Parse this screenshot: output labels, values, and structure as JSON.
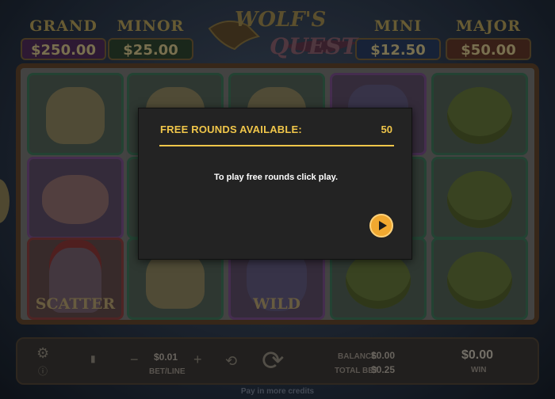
{
  "game": {
    "logo_line1": "WOLF'S",
    "logo_line2": "QUEST"
  },
  "jackpots": [
    {
      "name": "GRAND",
      "value": "$250.00"
    },
    {
      "name": "MINOR",
      "value": "$25.00"
    },
    {
      "name": "MINI",
      "value": "$12.50"
    },
    {
      "name": "MAJOR",
      "value": "$50.00"
    }
  ],
  "reels": {
    "symbols": [
      [
        "eagle",
        "bear",
        "scatter"
      ],
      [
        "eagle",
        "eagle",
        "eagle"
      ],
      [
        "eagle",
        "wolf",
        "wild"
      ],
      [
        "wolf",
        "snake",
        "snake"
      ],
      [
        "snake",
        "snake",
        "snake"
      ]
    ],
    "scatter_label": "SCATTER",
    "wild_label": "WILD"
  },
  "controls": {
    "bet_value": "$0.01",
    "bet_label": "BET/LINE",
    "balance_label": "BALANCE",
    "balance_value": "$0.00",
    "total_bet_label": "TOTAL BET",
    "total_bet_value": "$0.25",
    "win_value": "$0.00",
    "win_label": "WIN",
    "icons": [
      "gear-icon",
      "info-icon",
      "minus-icon",
      "plus-icon",
      "autoplay-icon",
      "spin-icon"
    ]
  },
  "footer": {
    "note": "Pay in more credits"
  },
  "dialog": {
    "title": "FREE ROUNDS AVAILABLE:",
    "count": "50",
    "message": "To play free rounds click play.",
    "accent_color": "#f0c64a",
    "play_button_color": "#f0a830"
  }
}
